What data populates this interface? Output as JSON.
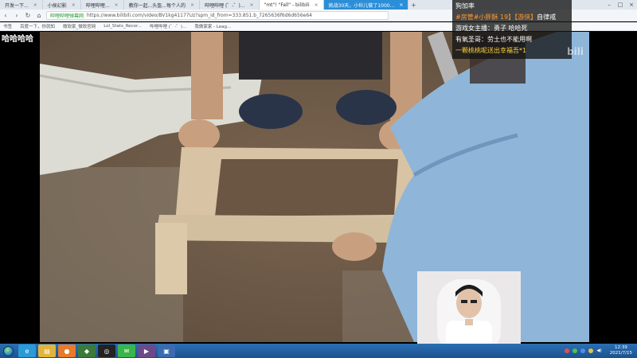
{
  "browser": {
    "tabs": [
      {
        "label": "开发一下..."
      },
      {
        "label": "小侯幻影"
      },
      {
        "label": "哔哩哔哩..."
      },
      {
        "label": "教你一起...头盔...每个人的"
      },
      {
        "label": "哔哩哔哩 (゜-゜)..."
      },
      {
        "label": "\"mt\"! \"Fall\" - bilibili"
      },
      {
        "label": "挑战30天，小伙儿做了1000..."
      }
    ],
    "url_site": "哔哩哔哩弹幕网",
    "url": "https://www.bilibili.com/video/BV1kg41177Uz?spm_id_from=333.851.b_7265636f6d6d656e64",
    "bookmarks": [
      "书签",
      "百度一下，你就知",
      "微软家_微软官网",
      "Lol_Stats_Recor...",
      "哔哩哔哩 (゜-゜)...",
      "我做家家 - Leag..."
    ]
  },
  "overlay": {
    "text": "哈哈哈哈"
  },
  "chat": {
    "header": "狗加率",
    "messages": [
      {
        "prefix": "#房管#小胖酥 19】",
        "badge": "【游侠】",
        "body": "自律戒"
      },
      {
        "user": "游戏女主播：",
        "body": "勇子  哈哈死"
      },
      {
        "user": "有氧圣哥：",
        "body": "劳土也不能用啊"
      },
      {
        "body": "一颗桃桃呢送出幸福吾*1"
      }
    ]
  },
  "watermark": "bili",
  "taskbar": {
    "time": "12:39",
    "date": "2021/7/15"
  },
  "colors": {
    "chat_orange": "#ff9a2a",
    "chat_gold": "#ffd23f",
    "taskbar": "#1c528d"
  }
}
